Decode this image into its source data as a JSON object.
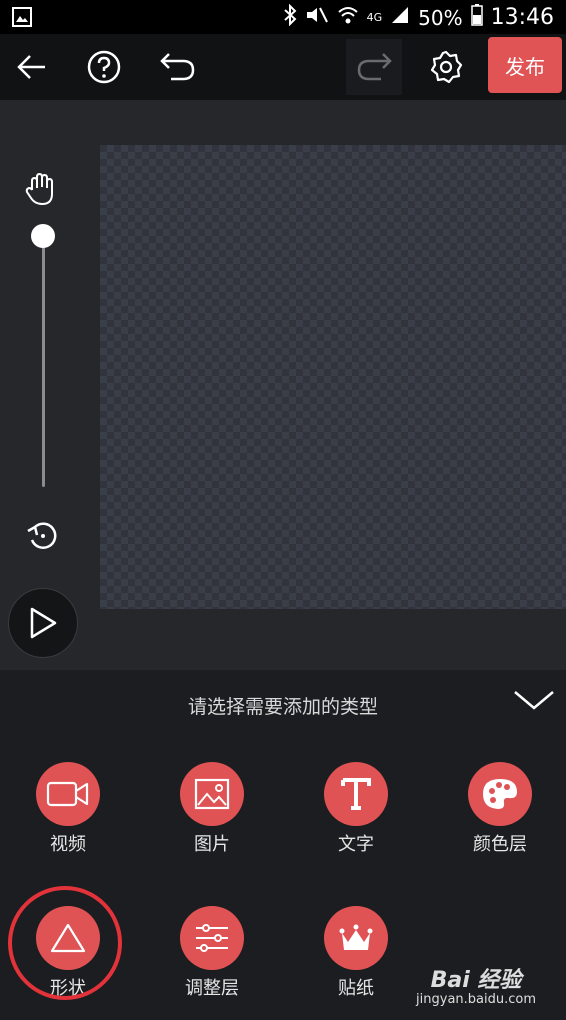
{
  "status_bar": {
    "battery": "50%",
    "time": "13:46",
    "network": "4G"
  },
  "toolbar": {
    "publish_label": "发布"
  },
  "panel": {
    "title": "请选择需要添加的类型",
    "items": [
      {
        "label": "视频",
        "icon": "video-camera-icon"
      },
      {
        "label": "图片",
        "icon": "image-icon"
      },
      {
        "label": "文字",
        "icon": "text-t-icon"
      },
      {
        "label": "颜色层",
        "icon": "palette-icon"
      },
      {
        "label": "形状",
        "icon": "triangle-icon"
      },
      {
        "label": "调整层",
        "icon": "sliders-icon"
      },
      {
        "label": "贴纸",
        "icon": "crown-icon"
      }
    ]
  },
  "watermark": {
    "brand": "Bai 经验",
    "site": "jingyan.baidu.com"
  },
  "colors": {
    "accent": "#df5355",
    "highlight": "#e3333a",
    "toolbar_bg": "#111214",
    "panel_bg": "#1c1d20"
  }
}
